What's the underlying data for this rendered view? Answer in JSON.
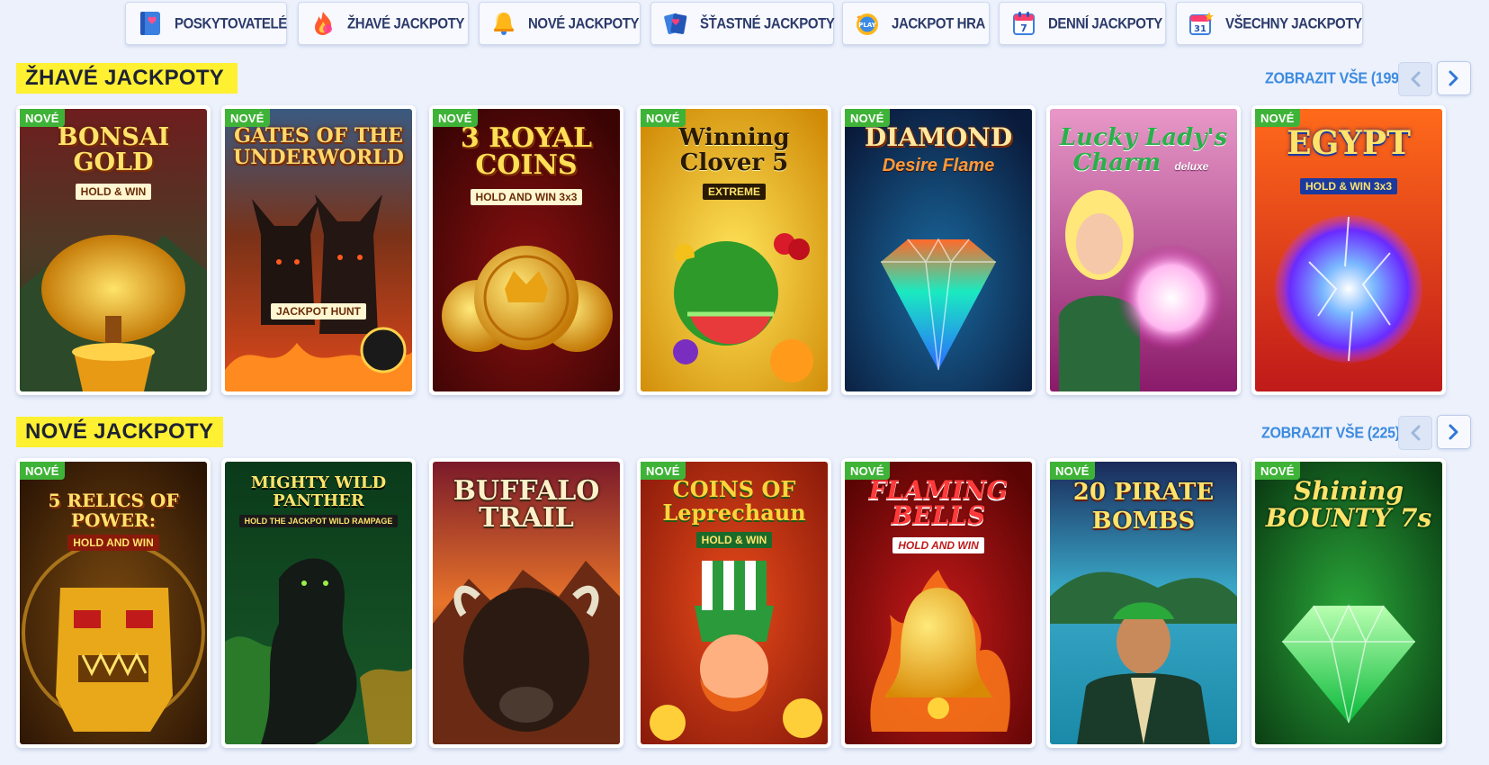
{
  "tabs": [
    {
      "label": "POSKYTOVATELÉ",
      "icon": "providers-book-icon"
    },
    {
      "label": "ŽHAVÉ JACKPOTY",
      "icon": "fire-icon"
    },
    {
      "label": "NOVÉ JACKPOTY",
      "icon": "bell-icon"
    },
    {
      "label": "ŠŤASTNÉ JACKPOTY",
      "icon": "lucky-cards-icon"
    },
    {
      "label": "JACKPOT HRA",
      "icon": "jackpot-coin-icon"
    },
    {
      "label": "DENNÍ JACKPOTY",
      "icon": "calendar-icon"
    },
    {
      "label": "VŠECHNY JACKPOTY",
      "icon": "calendar-star-icon"
    }
  ],
  "sections": [
    {
      "title": "ŽHAVÉ JACKPOTY",
      "show_all": "ZOBRAZIT VŠE (199)",
      "games": [
        {
          "title": "BONSAI GOLD",
          "subtitle": "HOLD & WIN",
          "badge": "NOVÉ"
        },
        {
          "title": "GATES OF THE UNDERWORLD",
          "subtitle": "JACKPOT HUNT",
          "badge": "NOVÉ"
        },
        {
          "title": "3 ROYAL COINS",
          "subtitle": "HOLD AND WIN 3x3",
          "badge": "NOVÉ"
        },
        {
          "title": "Winning Clover 5",
          "subtitle": "EXTREME",
          "badge": "NOVÉ"
        },
        {
          "title": "DIAMOND",
          "subtitle": "Desire Flame",
          "badge": "NOVÉ"
        },
        {
          "title": "Lucky Lady's Charm",
          "subtitle": "deluxe",
          "badge": ""
        },
        {
          "title": "EGYPT",
          "subtitle": "HOLD & WIN 3x3",
          "badge": "NOVÉ"
        }
      ]
    },
    {
      "title": "NOVÉ JACKPOTY",
      "show_all": "ZOBRAZIT VŠE (225)",
      "games": [
        {
          "title": "5 RELICS OF POWER:",
          "subtitle": "HOLD AND WIN",
          "badge": "NOVÉ"
        },
        {
          "title": "MIGHTY WILD PANTHER",
          "subtitle": "HOLD THE JACKPOT WILD RAMPAGE",
          "badge": ""
        },
        {
          "title": "BUFFALO TRAIL",
          "subtitle": "",
          "badge": ""
        },
        {
          "title": "COINS OF Leprechaun",
          "subtitle": "HOLD & WIN",
          "badge": "NOVÉ"
        },
        {
          "title": "FLAMING BELLS",
          "subtitle": "HOLD AND WIN",
          "badge": "NOVÉ"
        },
        {
          "title": "20 PIRATE BOMBS",
          "subtitle": "",
          "badge": "NOVÉ"
        },
        {
          "title": "Shining BOUNTY 7s",
          "subtitle": "",
          "badge": "NOVÉ"
        }
      ]
    }
  ],
  "colors": {
    "background": "#ecf1fc",
    "title_highlight": "#fff032",
    "link": "#3d8be0",
    "badge": "#3fb338",
    "tab_text": "#2c3a6b"
  }
}
